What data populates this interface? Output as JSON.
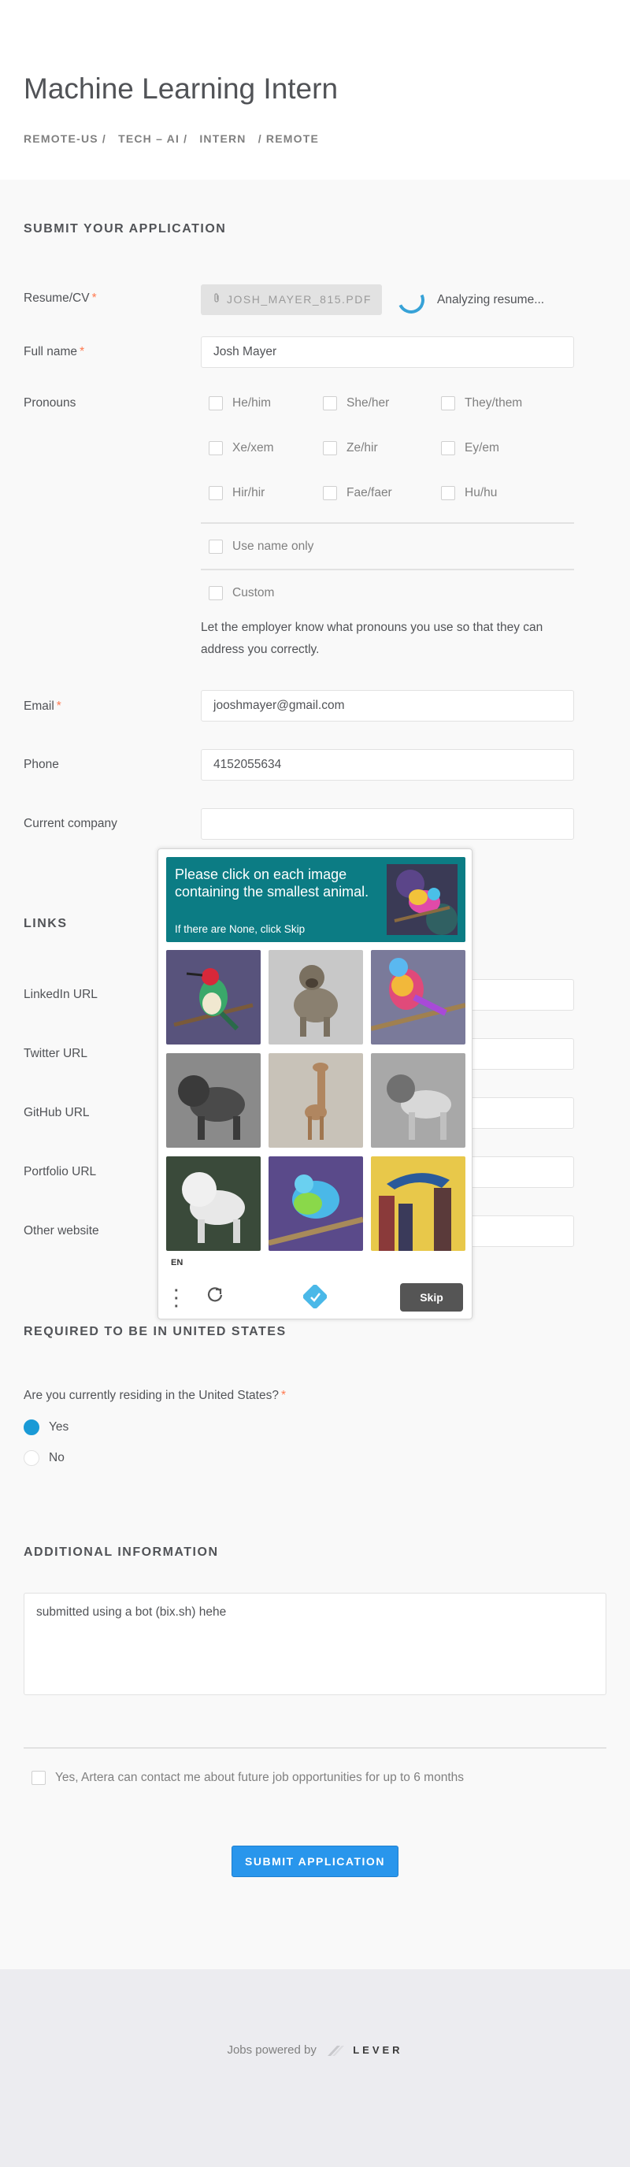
{
  "job": {
    "title": "Machine Learning Intern",
    "location": "REMOTE-US /",
    "team": "TECH – AI /",
    "commitment": "INTERN",
    "workplace": "/ REMOTE"
  },
  "application": {
    "section_title": "SUBMIT YOUR APPLICATION",
    "resume": {
      "label": "Resume/CV",
      "required_mark": "*",
      "file_name": "JOSH_MAYER_815.PDF",
      "status": "Analyzing resume..."
    },
    "full_name": {
      "label": "Full name",
      "required_mark": "*",
      "value": "Josh Mayer"
    },
    "pronouns": {
      "label": "Pronouns",
      "options": [
        "He/him",
        "She/her",
        "They/them",
        "Xe/xem",
        "Ze/hir",
        "Ey/em",
        "Hir/hir",
        "Fae/faer",
        "Hu/hu"
      ],
      "name_only": "Use name only",
      "custom": "Custom",
      "help": "Let the employer know what pronouns you use so that they can address you correctly."
    },
    "email": {
      "label": "Email",
      "required_mark": "*",
      "value": "jooshmayer@gmail.com"
    },
    "phone": {
      "label": "Phone",
      "value": "4152055634"
    },
    "current_company": {
      "label": "Current company",
      "value": ""
    }
  },
  "links": {
    "section_title": "LINKS",
    "items": [
      {
        "label": "LinkedIn URL",
        "value": ""
      },
      {
        "label": "Twitter URL",
        "value": ""
      },
      {
        "label": "GitHub URL",
        "value": ""
      },
      {
        "label": "Portfolio URL",
        "value": ""
      },
      {
        "label": "Other website",
        "value": ""
      }
    ]
  },
  "us_requirement": {
    "section_title": "REQUIRED TO BE IN UNITED STATES",
    "question": "Are you currently residing in the United States?",
    "required_mark": "*",
    "options": [
      "Yes",
      "No"
    ],
    "selected": "Yes"
  },
  "additional": {
    "section_title": "ADDITIONAL INFORMATION",
    "value": "submitted using a bot (bix.sh) hehe"
  },
  "consent": {
    "label": "Yes, Artera can contact me about future job opportunities for up to 6 months"
  },
  "submit_label": "SUBMIT APPLICATION",
  "footer": {
    "powered_by": "Jobs powered by",
    "brand": "LEVER"
  },
  "captcha": {
    "prompt": "Please click on each image containing the smallest animal.",
    "sub": "If there are None, click Skip",
    "tiles": [
      "bird-image",
      "dog-image",
      "bird-image",
      "lion-image",
      "giraffe-image",
      "lion-image",
      "lion-image",
      "bird-image",
      "dolphin-image"
    ],
    "language": "EN",
    "skip_label": "Skip",
    "colors": {
      "header": "#0c7c84",
      "skip": "#555555"
    }
  },
  "colors": {
    "accent": "#2996ec",
    "required": "#ff794f",
    "selected_radio": "#1a9ad6"
  }
}
